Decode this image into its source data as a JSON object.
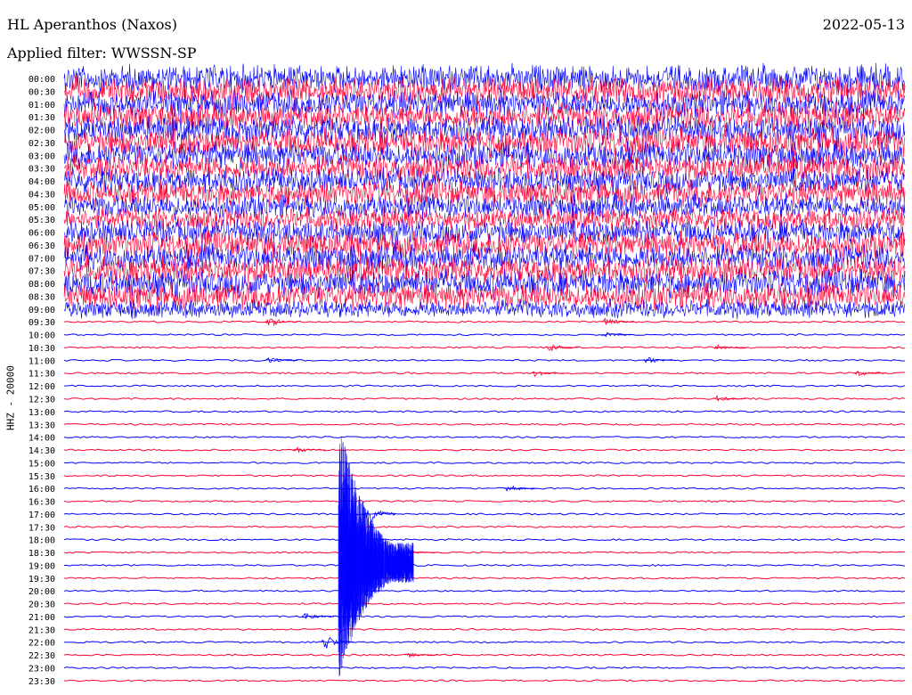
{
  "header": {
    "station": "HL Aperanthos (Naxos)",
    "date": "2022-05-13",
    "filter": "Applied filter: WWSSN-SP"
  },
  "axis": {
    "channel_label": "HHZ - 20000"
  },
  "colors": {
    "red": "#ff0033",
    "blue": "#0000ff",
    "text": "#000000"
  },
  "chart_data": {
    "type": "line",
    "title": "HL Aperanthos (Naxos)",
    "subtitle": "Applied filter: WWSSN-SP",
    "ylabel": "HHZ - 20000",
    "rows": [
      "00:00",
      "00:30",
      "01:00",
      "01:30",
      "02:00",
      "02:30",
      "03:00",
      "03:30",
      "04:00",
      "04:30",
      "05:00",
      "05:30",
      "06:00",
      "06:30",
      "07:00",
      "07:30",
      "08:00",
      "08:30",
      "09:00",
      "09:30",
      "10:00",
      "10:30",
      "11:00",
      "11:30",
      "12:00",
      "12:30",
      "13:00",
      "13:30",
      "14:00",
      "14:30",
      "15:00",
      "15:30",
      "16:00",
      "16:30",
      "17:00",
      "17:30",
      "18:00",
      "18:30",
      "19:00",
      "19:30",
      "20:00",
      "20:30",
      "21:00",
      "21:30",
      "22:00",
      "22:30",
      "23:00",
      "23:30"
    ],
    "row_amplitude": [
      0.9,
      0.95,
      0.9,
      0.95,
      0.9,
      0.95,
      0.9,
      0.9,
      0.85,
      0.85,
      0.8,
      0.75,
      0.85,
      0.9,
      0.9,
      0.9,
      0.9,
      0.9,
      0.6,
      0.05,
      0.05,
      0.05,
      0.05,
      0.05,
      0.05,
      0.05,
      0.05,
      0.04,
      0.04,
      0.04,
      0.04,
      0.04,
      0.04,
      0.04,
      0.04,
      0.04,
      0.04,
      0.04,
      0.04,
      0.04,
      0.04,
      0.04,
      0.04,
      0.04,
      0.04,
      0.04,
      0.04,
      0.04
    ],
    "events": [
      {
        "row": "09:30",
        "minute": 7.5,
        "amp": 0.6
      },
      {
        "row": "09:30",
        "minute": 19.5,
        "amp": 0.5
      },
      {
        "row": "10:00",
        "minute": 19.5,
        "amp": 0.3
      },
      {
        "row": "10:30",
        "minute": 17.5,
        "amp": 0.5
      },
      {
        "row": "10:30",
        "minute": 23.5,
        "amp": 0.4
      },
      {
        "row": "11:00",
        "minute": 7.5,
        "amp": 0.4
      },
      {
        "row": "11:00",
        "minute": 21.0,
        "amp": 0.4
      },
      {
        "row": "11:30",
        "minute": 17.0,
        "amp": 0.5
      },
      {
        "row": "11:30",
        "minute": 28.5,
        "amp": 0.4
      },
      {
        "row": "12:30",
        "minute": 23.5,
        "amp": 0.4
      },
      {
        "row": "14:30",
        "minute": 8.5,
        "amp": 0.3
      },
      {
        "row": "16:00",
        "minute": 16.0,
        "amp": 0.5
      },
      {
        "row": "17:00",
        "minute": 11.0,
        "amp": 1.6
      },
      {
        "row": "18:30",
        "minute": 12.5,
        "amp": 0.3
      },
      {
        "row": "21:00",
        "minute": 8.8,
        "amp": 0.5
      },
      {
        "row": "22:00",
        "minute": 9.5,
        "amp": 1.0
      },
      {
        "row": "22:30",
        "minute": 12.5,
        "amp": 0.3
      }
    ],
    "mainshock": {
      "row": "19:00",
      "minute": 9.8
    }
  }
}
